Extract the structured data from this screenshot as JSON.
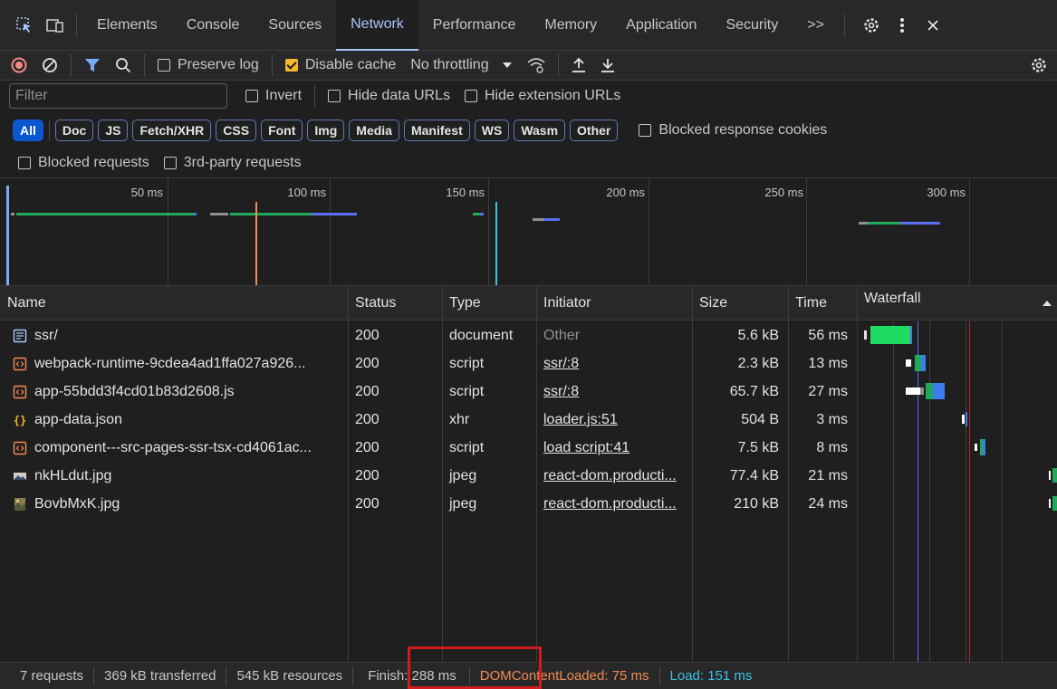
{
  "tabs": {
    "items": [
      "Elements",
      "Console",
      "Sources",
      "Network",
      "Performance",
      "Memory",
      "Application",
      "Security"
    ],
    "more": ">>"
  },
  "toolbar": {
    "preserve_log": "Preserve log",
    "disable_cache": "Disable cache",
    "throttling": "No throttling"
  },
  "filter": {
    "placeholder": "Filter",
    "invert": "Invert",
    "hide_data_urls": "Hide data URLs",
    "hide_extension_urls": "Hide extension URLs"
  },
  "type_filters": [
    "All",
    "Doc",
    "JS",
    "Fetch/XHR",
    "CSS",
    "Font",
    "Img",
    "Media",
    "Manifest",
    "WS",
    "Wasm",
    "Other"
  ],
  "blocked_response_cookies": "Blocked response cookies",
  "blocked_requests": "Blocked requests",
  "third_party_requests": "3rd-party requests",
  "overview": {
    "ticks": [
      "50 ms",
      "100 ms",
      "150 ms",
      "200 ms",
      "250 ms",
      "300 ms"
    ]
  },
  "columns": {
    "name": "Name",
    "status": "Status",
    "type": "Type",
    "initiator": "Initiator",
    "size": "Size",
    "time": "Time",
    "waterfall": "Waterfall"
  },
  "requests": [
    {
      "name": "ssr/",
      "status": "200",
      "type": "document",
      "initiator": "Other",
      "size": "5.6 kB",
      "time": "56 ms",
      "icon": "document-icon"
    },
    {
      "name": "webpack-runtime-9cdea4ad1ffa027a926...",
      "status": "200",
      "type": "script",
      "initiator": "ssr/:8",
      "size": "2.3 kB",
      "time": "13 ms",
      "icon": "script-icon"
    },
    {
      "name": "app-55bdd3f4cd01b83d2608.js",
      "status": "200",
      "type": "script",
      "initiator": "ssr/:8",
      "size": "65.7 kB",
      "time": "27 ms",
      "icon": "script-icon"
    },
    {
      "name": "app-data.json",
      "status": "200",
      "type": "xhr",
      "initiator": "loader.js:51",
      "size": "504 B",
      "time": "3 ms",
      "icon": "json-icon"
    },
    {
      "name": "component---src-pages-ssr-tsx-cd4061ac...",
      "status": "200",
      "type": "script",
      "initiator": "load script:41",
      "size": "7.5 kB",
      "time": "8 ms",
      "icon": "script-icon"
    },
    {
      "name": "nkHLdut.jpg",
      "status": "200",
      "type": "jpeg",
      "initiator": "react-dom.producti...",
      "size": "77.4 kB",
      "time": "21 ms",
      "icon": "image-icon"
    },
    {
      "name": "BovbMxK.jpg",
      "status": "200",
      "type": "jpeg",
      "initiator": "react-dom.producti...",
      "size": "210 kB",
      "time": "24 ms",
      "icon": "image-icon"
    }
  ],
  "status_bar": {
    "requests": "7 requests",
    "transferred": "369 kB transferred",
    "resources": "545 kB resources",
    "finish": "Finish: 288 ms",
    "dom_content_loaded": "DOMContentLoaded: 75 ms",
    "load": "Load: 151 ms"
  },
  "colors": {
    "accent": "#a8c7fa",
    "dcl": "#f28b54",
    "load": "#3fc0e6",
    "highlight": "#d01c1c"
  }
}
